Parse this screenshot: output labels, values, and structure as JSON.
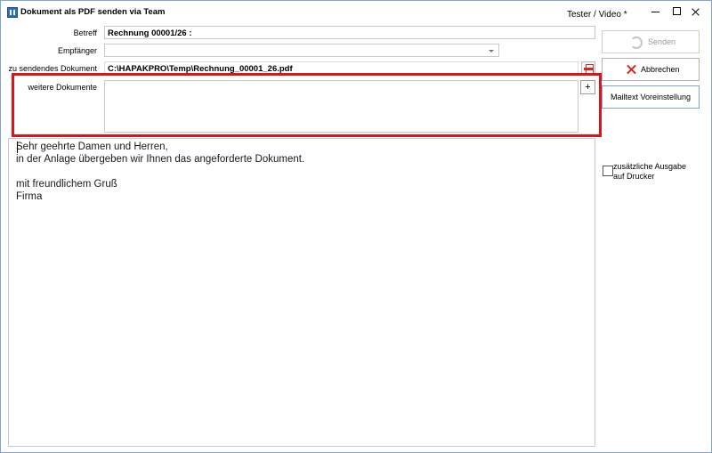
{
  "window": {
    "title": "Dokument als PDF senden via Team",
    "user": "Tester / Video *",
    "icon": "app-icon"
  },
  "form": {
    "subject_label": "Betreff",
    "subject_value": "Rechnung 00001/26 :",
    "recipient_label": "Empfänger",
    "recipient_value": "",
    "document_label": "zu sendendes Dokument",
    "document_value": "C:\\HAPAKPRO\\Temp\\Rechnung_00001_26.pdf",
    "further_docs_label": "weitere Dokumente",
    "add_button": "+"
  },
  "message": {
    "lines": [
      "Sehr geehrte Damen und Herren,",
      "in der Anlage übergeben wir Ihnen das angeforderte Dokument.",
      "",
      "mit freundlichem Gruß",
      "Firma"
    ]
  },
  "actions": {
    "send_label": "Senden",
    "cancel_label": "Abbrechen",
    "mailtext_label": "Mailtext Voreinstellung"
  },
  "options": {
    "printer_label": "zusätzliche Ausgabe auf Drucker",
    "printer_checked": false
  },
  "colors": {
    "highlight": "#d9141c",
    "cancel_icon": "#d9261c",
    "disabled_text": "#9a9a9a"
  }
}
